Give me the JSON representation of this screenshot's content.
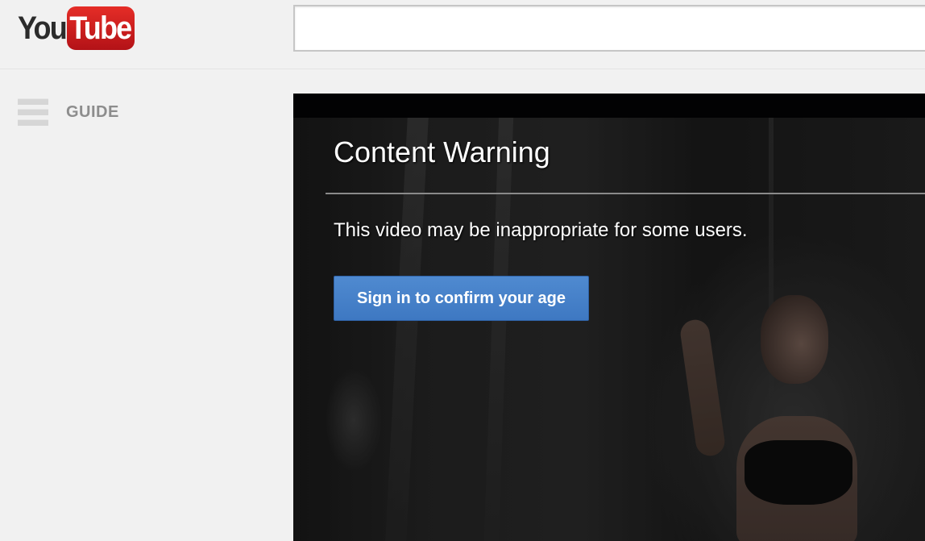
{
  "brand": {
    "logo_you": "You",
    "logo_tube": "Tube"
  },
  "search": {
    "value": "",
    "placeholder": ""
  },
  "guide": {
    "label": "GUIDE",
    "icon": "hamburger-icon"
  },
  "player": {
    "warning_title": "Content Warning",
    "warning_message": "This video may be inappropriate for some users.",
    "signin_button_label": "Sign in to confirm your age"
  },
  "colors": {
    "logo_red": "#cc181e",
    "button_blue": "#4a86cc",
    "background": "#f1f1f1",
    "player_black": "#020203"
  }
}
